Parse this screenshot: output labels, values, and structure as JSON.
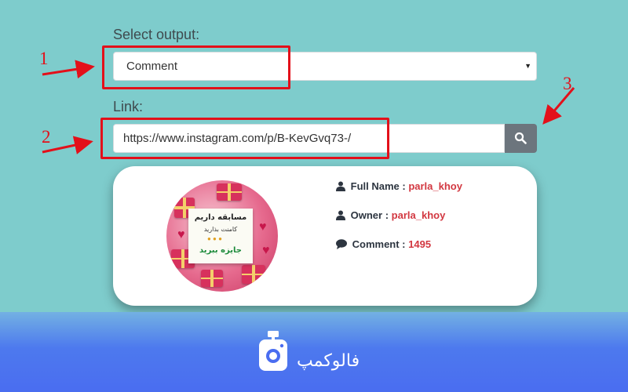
{
  "form": {
    "select_label": "Select output:",
    "select_value": "Comment",
    "link_label": "Link:",
    "link_value": "https://www.instagram.com/p/B-KevGvq73-/"
  },
  "annotations": {
    "marker_1": "1",
    "marker_2": "2",
    "marker_3": "3"
  },
  "result": {
    "post_text": {
      "line1": "مسابقه داریم",
      "line2": "کامنت بذارید",
      "line3": "جایزه ببرید"
    },
    "full_name_label": "Full Name :",
    "full_name_value": "parla_khoy",
    "owner_label": "Owner :",
    "owner_value": "parla_khoy",
    "comment_label": "Comment :",
    "comment_value": "1495"
  },
  "brand": {
    "name": "فالوکمپ"
  },
  "colors": {
    "background": "#7ecccc",
    "annotation_red": "#e3101a",
    "value_red": "#d23740",
    "footer_blue": "#4a6df0"
  },
  "icons": [
    "chevron-down-icon",
    "search-icon",
    "user-icon",
    "comment-icon",
    "camera-icon",
    "red-arrow"
  ]
}
